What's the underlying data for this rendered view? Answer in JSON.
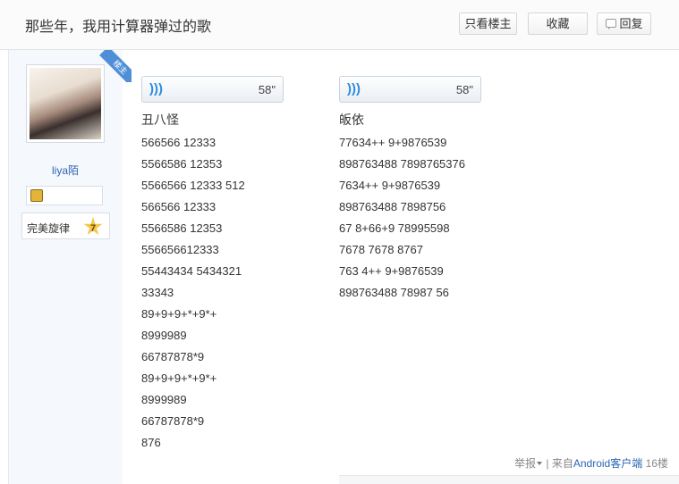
{
  "header": {
    "title": "那些年，我用计算器弹过的歌",
    "only_op_label": "只看楼主",
    "favorite_label": "收藏",
    "reply_label": "回复"
  },
  "author": {
    "badge": "楼主",
    "name": "liya陌",
    "level_name": "完美旋律",
    "level_num": "7"
  },
  "posts": [
    {
      "voice_duration": "58\"",
      "song": "丑八怪",
      "lines": [
        "566566 12333",
        "5566586 12353",
        "5566566 12333 512",
        "566566 12333",
        "5566586 12353",
        "556656612333",
        "55443434 5434321",
        "33343",
        "89+9+9+*+9*+",
        "8999989",
        "66787878*9",
        "89+9+9+*+9*+",
        "8999989",
        "66787878*9",
        "876"
      ]
    },
    {
      "voice_duration": "58\"",
      "song": "皈依",
      "lines": [
        "77634++ 9+9876539",
        "898763488 7898765376",
        "7634++ 9+9876539",
        "898763488 7898756",
        "67 8+66+9 78995598",
        "7678 7678 8767",
        "763 4++ 9+9876539",
        "898763488 78987 56"
      ]
    }
  ],
  "footer": {
    "report": "举报",
    "sep": "|",
    "from": "来自",
    "client": "Android客户端",
    "floor": "16楼"
  }
}
